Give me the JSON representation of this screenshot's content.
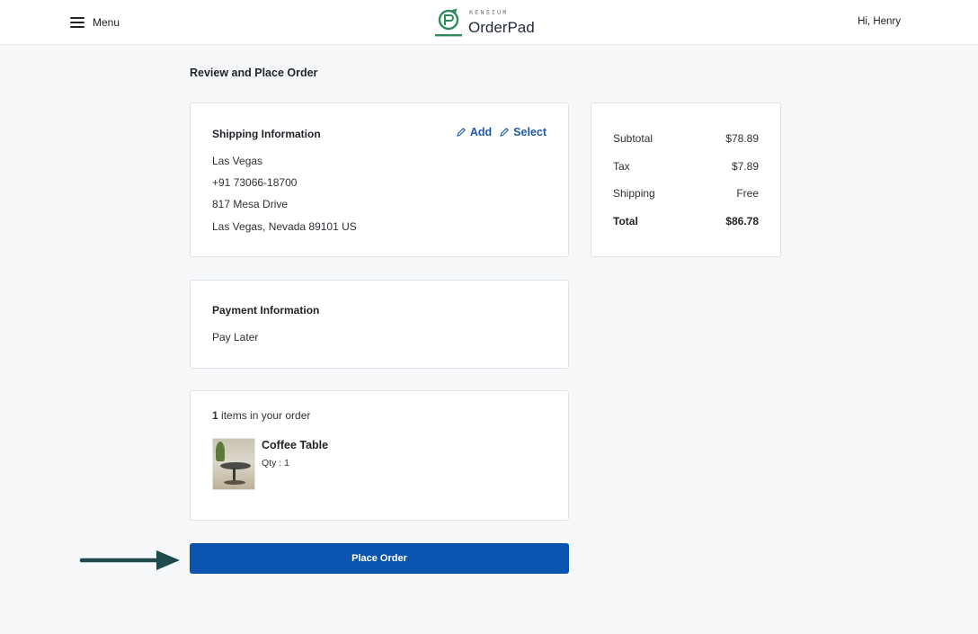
{
  "header": {
    "menu_label": "Menu",
    "logo_brand": "KENSIUM",
    "logo_name": "OrderPad",
    "greeting": "Hi, Henry"
  },
  "page": {
    "title": "Review and Place Order"
  },
  "shipping": {
    "title": "Shipping Information",
    "add_label": "Add",
    "select_label": "Select",
    "name": "Las Vegas",
    "phone": "+91 73066-18700",
    "street": "817 Mesa Drive",
    "city_line": "Las Vegas, Nevada 89101 US"
  },
  "payment": {
    "title": "Payment Information",
    "method": "Pay Later"
  },
  "order_items": {
    "count": "1",
    "count_suffix": " items in your order",
    "items": [
      {
        "name": "Coffee Table",
        "qty": "Qty : 1"
      }
    ]
  },
  "summary": {
    "subtotal_label": "Subtotal",
    "subtotal_value": "$78.89",
    "tax_label": "Tax",
    "tax_value": "$7.89",
    "shipping_label": "Shipping",
    "shipping_value": "Free",
    "total_label": "Total",
    "total_value": "$86.78"
  },
  "actions": {
    "place_order_label": "Place Order"
  },
  "colors": {
    "primary": "#0b55b0",
    "link": "#1d5ba8",
    "logo_green": "#2f8a5c",
    "arrow": "#1d4a4c"
  }
}
